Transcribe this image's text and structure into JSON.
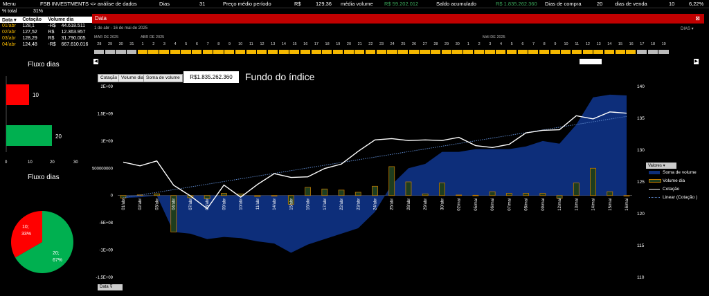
{
  "topbar": {
    "menu": "Menu",
    "title": "FSB INVESTMENTS <> análise de dados",
    "dias_label": "Dias",
    "dias_value": "31",
    "preco_label": "Preço médio período",
    "preco_currency": "R$",
    "preco_value": "129,36",
    "media_label": "média volume",
    "media_value": "R$ 59.202.012",
    "saldo_label": "Saldo acumulado",
    "saldo_value": "R$ 1.835.262.360",
    "compra_label": "Dias de compra",
    "compra_value": "20",
    "venda_label": "dias de venda",
    "venda_value": "10",
    "pct_value": "6,22%"
  },
  "summary": {
    "pct_label": "% total",
    "pct_value": "31%"
  },
  "datatable": {
    "headers": [
      "Data",
      "Cotação",
      "Volume dia",
      "So"
    ],
    "rows": [
      [
        "01/abr",
        "128,1",
        "-R$",
        "44.618.511"
      ],
      [
        "02/abr",
        "127,52",
        "R$",
        "12.363.957"
      ],
      [
        "03/abr",
        "128,29",
        "R$",
        "31.790.005"
      ],
      [
        "04/abr",
        "124,48",
        "-R$",
        "667.610.016"
      ]
    ]
  },
  "fluxo_bar": {
    "title": "Fluxo dias",
    "bars": [
      {
        "label": "10",
        "value": 10,
        "color": "#ff0000"
      },
      {
        "label": "20",
        "value": 20,
        "color": "#00b050"
      }
    ],
    "ticks": [
      "0",
      "10",
      "20",
      "30"
    ]
  },
  "fluxo_pie": {
    "title": "Fluxo dias",
    "slices": [
      {
        "label": "10;",
        "pct": "33%",
        "value": 10,
        "color": "#ff0000"
      },
      {
        "label": "20;",
        "pct": "67%",
        "value": 20,
        "color": "#00b050"
      }
    ]
  },
  "slicer": {
    "title": "Data",
    "range_text": "1 de abr - 16 de mai de 2025",
    "unit": "DIAS",
    "months": [
      "MAR DE 2025",
      "ABR DE 2025",
      "MAI DE 2025"
    ],
    "days": [
      "28",
      "29",
      "30",
      "31",
      "1",
      "2",
      "3",
      "4",
      "5",
      "6",
      "7",
      "8",
      "9",
      "10",
      "11",
      "12",
      "13",
      "14",
      "15",
      "16",
      "17",
      "18",
      "19",
      "20",
      "21",
      "22",
      "23",
      "24",
      "25",
      "26",
      "27",
      "28",
      "29",
      "30",
      "1",
      "2",
      "3",
      "4",
      "5",
      "6",
      "7",
      "8",
      "9",
      "10",
      "11",
      "12",
      "13",
      "14",
      "15",
      "16",
      "17",
      "18",
      "19"
    ],
    "selected_from": 4,
    "selected_to": 49
  },
  "chart_buttons": [
    "Cotação",
    "Volume dia",
    "Soma de volume"
  ],
  "fundo": {
    "value": "R$1.835.262.360",
    "title": "Fundo do índice"
  },
  "legend": {
    "header": "Valores",
    "items": [
      {
        "label": "Soma de volume",
        "color": "#0d2e7a"
      },
      {
        "label": "Volume dia",
        "color": "#c07a00"
      },
      {
        "label": "Cotação",
        "color": "#ffffff"
      },
      {
        "label": "Linear (Cotação )",
        "color": "#5b86c9"
      }
    ]
  },
  "footer": {
    "data_button": "Data"
  },
  "chart_data": {
    "type": "combo",
    "categories": [
      "01/abr",
      "02/abr",
      "03/abr",
      "04/abr",
      "07/abr",
      "08/abr",
      "09/abr",
      "10/abr",
      "11/abr",
      "14/abr",
      "15/abr",
      "16/abr",
      "17/abr",
      "22/abr",
      "23/abr",
      "24/abr",
      "25/abr",
      "28/abr",
      "29/abr",
      "30/abr",
      "02/mai",
      "05/mai",
      "06/mai",
      "07/mai",
      "08/mai",
      "09/mai",
      "12/mai",
      "13/mai",
      "14/mai",
      "15/mai",
      "16/mai"
    ],
    "y_left_ticks": [
      "2E+09",
      "1,5E+09",
      "1E+09",
      "500000000",
      "0",
      "-5E+08",
      "-1E+09",
      "-1,5E+09"
    ],
    "y_left_range": [
      -1500000000,
      2000000000
    ],
    "y_right_ticks": [
      "140",
      "135",
      "130",
      "125",
      "120",
      "115",
      "110"
    ],
    "y_right_range": [
      110,
      140
    ],
    "series": [
      {
        "name": "Soma de volume",
        "kind": "area",
        "axis": "left",
        "values": [
          -44618511,
          -32254554,
          -464549,
          -668074565,
          -700000000,
          -800000000,
          -760000000,
          -780000000,
          -840000000,
          -880000000,
          -1050000000,
          -900000000,
          -800000000,
          -700000000,
          -600000000,
          -300000000,
          200000000,
          500000000,
          580000000,
          800000000,
          800000000,
          850000000,
          850000000,
          850000000,
          900000000,
          1000000000,
          950000000,
          1300000000,
          1800000000,
          1850000000,
          1835262360
        ]
      },
      {
        "name": "Volume dia",
        "kind": "bar",
        "axis": "left",
        "values": [
          -44618511,
          12363957,
          31790005,
          -667610016,
          -40000000,
          -60000000,
          40000000,
          30000000,
          -20000000,
          -10000000,
          -160000000,
          150000000,
          120000000,
          100000000,
          60000000,
          170000000,
          530000000,
          250000000,
          30000000,
          230000000,
          10000000,
          5000000,
          70000000,
          40000000,
          40000000,
          40000000,
          -50000000,
          230000000,
          500000000,
          70000000,
          0
        ]
      },
      {
        "name": "Cotação",
        "kind": "line",
        "axis": "right",
        "values": [
          128.1,
          127.52,
          128.29,
          124.48,
          122.8,
          120.8,
          124.5,
          122.6,
          124.6,
          126.3,
          125.7,
          125.8,
          127.1,
          127.8,
          129.8,
          131.6,
          131.8,
          131.5,
          131.6,
          131.5,
          132.0,
          130.7,
          130.4,
          130.9,
          132.7,
          133.1,
          133.2,
          135.4,
          134.9,
          136.0,
          135.8
        ]
      },
      {
        "name": "Linear (Cotação )",
        "kind": "trendline",
        "axis": "right",
        "values": [
          122.5,
          135.3
        ]
      }
    ]
  }
}
